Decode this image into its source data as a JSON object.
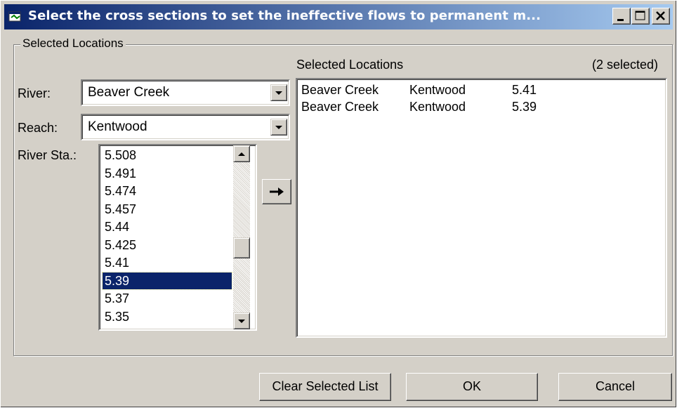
{
  "window": {
    "title": "Select the cross sections to set the ineffective flows to permanent m...",
    "minimize_icon": "minimize-icon",
    "maximize_icon": "maximize-icon",
    "close_icon": "close-icon",
    "title_icon": "app-icon",
    "title_gradient_start": "#0a246a",
    "title_gradient_end": "#a6caf0"
  },
  "group": {
    "label": "Selected Locations"
  },
  "filters": {
    "river_label": "River:",
    "river_value": "Beaver Creek",
    "reach_label": "Reach:",
    "reach_value": "Kentwood",
    "station_label": "River Sta.:"
  },
  "stations": {
    "items": [
      "5.508",
      "5.491",
      "5.474",
      "5.457",
      "5.44",
      "5.425",
      "5.41",
      "5.39",
      "5.37",
      "5.35"
    ],
    "selected": "5.39"
  },
  "add_button_icon": "right-arrow-icon",
  "selected_panel": {
    "label": "Selected Locations",
    "count_text": "(2 selected)",
    "rows": [
      {
        "river": "Beaver Creek",
        "reach": "Kentwood",
        "station": "5.41"
      },
      {
        "river": "Beaver Creek",
        "reach": "Kentwood",
        "station": "5.39"
      }
    ]
  },
  "buttons": {
    "clear": "Clear Selected List",
    "ok": "OK",
    "cancel": "Cancel"
  },
  "colors": {
    "face": "#d4d0c8",
    "selection": "#0a246a"
  }
}
